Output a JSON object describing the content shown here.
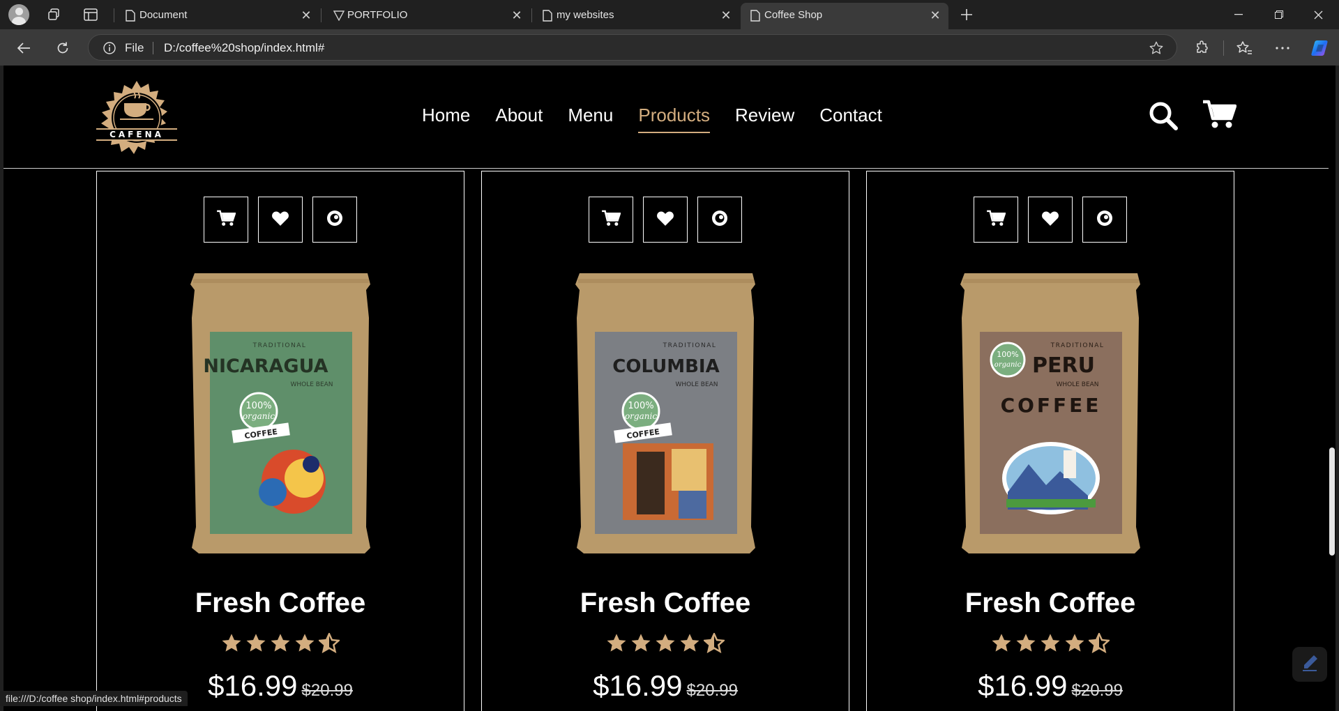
{
  "browser": {
    "tabs": [
      {
        "label": "Document",
        "icon": "page-icon",
        "active": false
      },
      {
        "label": "PORTFOLIO",
        "icon": "vite-icon",
        "active": false
      },
      {
        "label": "my websites",
        "icon": "page-icon",
        "active": false
      },
      {
        "label": "Coffee Shop",
        "icon": "page-icon",
        "active": true
      }
    ],
    "address": {
      "scheme_label": "File",
      "url": "D:/coffee%20shop/index.html#"
    },
    "status_url": "file:///D:/coffee shop/index.html#products"
  },
  "site": {
    "logo_text": "CAFENA",
    "nav": [
      {
        "label": "Home",
        "active": false
      },
      {
        "label": "About",
        "active": false
      },
      {
        "label": "Menu",
        "active": false
      },
      {
        "label": "Products",
        "active": true
      },
      {
        "label": "Review",
        "active": false
      },
      {
        "label": "Contact",
        "active": false
      }
    ],
    "accent_color": "#d3ad7f"
  },
  "products": [
    {
      "name": "Fresh Coffee",
      "price": "$16.99",
      "old_price": "$20.99",
      "rating": 4.5,
      "origin": "NICARAGUA",
      "bag_color": "#5f8f6a"
    },
    {
      "name": "Fresh Coffee",
      "price": "$16.99",
      "old_price": "$20.99",
      "rating": 4.5,
      "origin": "COLUMBIA",
      "bag_color": "#7c7f84"
    },
    {
      "name": "Fresh Coffee",
      "price": "$16.99",
      "old_price": "$20.99",
      "rating": 4.5,
      "origin": "PERU",
      "bag_color": "#8b6f5e"
    }
  ]
}
